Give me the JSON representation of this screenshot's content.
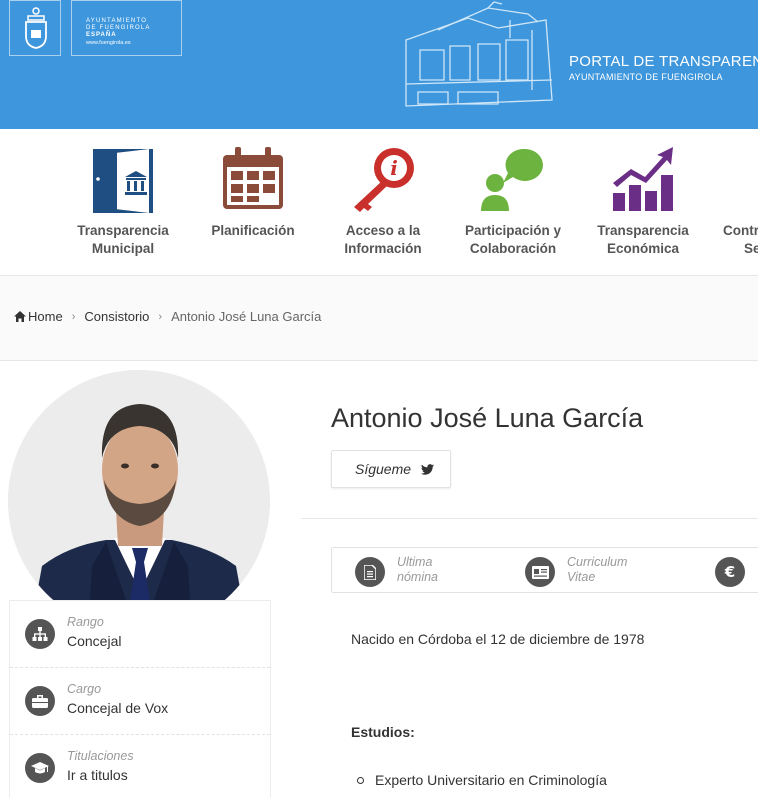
{
  "header": {
    "ayto_line1": "AYUNTAMIENTO",
    "ayto_line2": "DE FUENGIROLA",
    "ayto_line3": "ESPAÑA",
    "ayto_url": "www.fuengirola.es",
    "portal_title": "PORTAL DE TRANSPARENCIA",
    "portal_subtitle": "AYUNTAMIENTO DE FUENGIROLA"
  },
  "nav": {
    "items": [
      {
        "label_line1": "Transparencia",
        "label_line2": "Municipal",
        "icon": "door-building-icon",
        "color": "#1f4f82"
      },
      {
        "label_line1": "Planificación",
        "label_line2": "",
        "icon": "calendar-icon",
        "color": "#8a4b38"
      },
      {
        "label_line1": "Acceso a la",
        "label_line2": "Información",
        "icon": "key-info-icon",
        "color": "#c9302c"
      },
      {
        "label_line1": "Participación y",
        "label_line2": "Colaboración",
        "icon": "person-chat-icon",
        "color": "#6db33f"
      },
      {
        "label_line1": "Transparencia",
        "label_line2": "Económica",
        "icon": "bar-chart-icon",
        "color": "#6b2e86"
      },
      {
        "label_line1": "Contr",
        "label_line2": "Se",
        "icon": "person-icon",
        "color": "#3e97dc"
      }
    ]
  },
  "breadcrumb": {
    "home": "Home",
    "level1": "Consistorio",
    "current": "Antonio José Luna García"
  },
  "profile": {
    "name": "Antonio José Luna García",
    "follow_label": "Sígueme",
    "info": [
      {
        "key": "Rango",
        "value": "Concejal",
        "icon": "hierarchy-icon"
      },
      {
        "key": "Cargo",
        "value": "Concejal de Vox",
        "icon": "briefcase-icon"
      },
      {
        "key": "Titulaciones",
        "value": "Ir a titulos",
        "icon": "graduation-cap-icon"
      }
    ],
    "docs": [
      {
        "line1": "Ultima",
        "line2": "nómina",
        "icon": "document-icon"
      },
      {
        "line1": "Curriculum",
        "line2": "Vitae",
        "icon": "id-card-icon"
      },
      {
        "line1": "",
        "line2": "",
        "icon": "euro-icon"
      }
    ],
    "bio": "Nacido en Córdoba el 12 de diciembre de 1978",
    "studies_heading": "Estudios:",
    "studies": [
      "Experto Universitario en Criminología"
    ]
  },
  "colors": {
    "header_bg": "#3e97dc",
    "icon_circle": "#555555"
  }
}
